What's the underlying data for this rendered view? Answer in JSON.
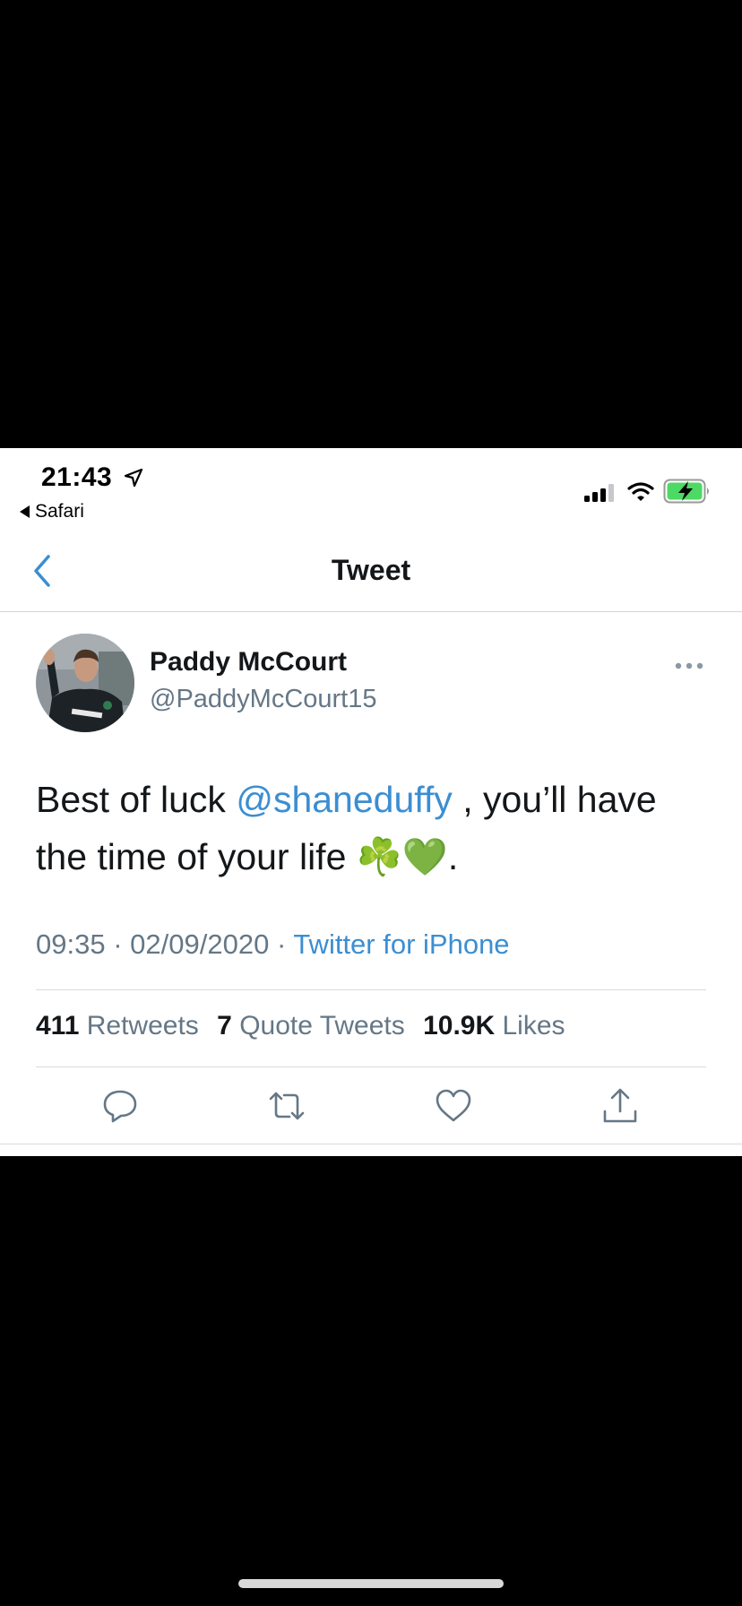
{
  "status_bar": {
    "time": "21:43",
    "back_app": "Safari",
    "icons": [
      "location-arrow-icon",
      "signal-icon",
      "wifi-icon",
      "battery-charging-icon"
    ]
  },
  "nav": {
    "title": "Tweet",
    "back_icon": "chevron-left-icon"
  },
  "tweet": {
    "author_name": "Paddy McCourt",
    "author_handle": "@PaddyMcCourt15",
    "text_before": "Best of luck ",
    "mention": "@shaneduffy",
    "text_after": " , you’ll have the time of your life ☘️💚.",
    "time": "09:35",
    "date": "02/09/2020",
    "separator": "·",
    "source": "Twitter for iPhone"
  },
  "stats": {
    "retweets_count": "411",
    "retweets_label": "Retweets",
    "quotes_count": "7",
    "quotes_label": "Quote Tweets",
    "likes_count": "10.9K",
    "likes_label": "Likes"
  },
  "actions": [
    "reply-icon",
    "retweet-icon",
    "like-icon",
    "share-icon"
  ],
  "colors": {
    "accent": "#3b8ed2",
    "text": "#14171a",
    "secondary": "#657786",
    "battery": "#4cd964"
  }
}
